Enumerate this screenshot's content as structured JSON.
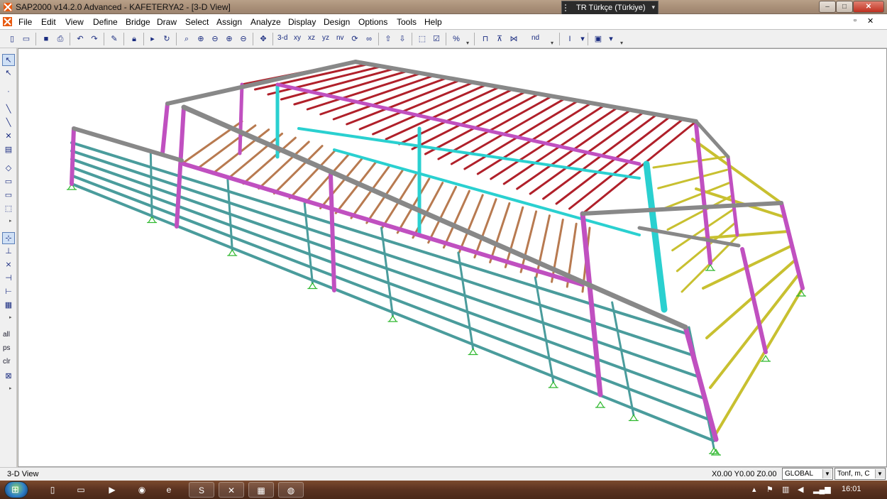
{
  "window": {
    "title": "SAP2000 v14.2.0 Advanced  - KAFETERYA2 - [3-D View]",
    "language": "TR Türkçe (Türkiye)",
    "minimize": "–",
    "maximize": "□",
    "close": "✕"
  },
  "menu": {
    "items": [
      "File",
      "Edit",
      "View",
      "Define",
      "Bridge",
      "Draw",
      "Select",
      "Assign",
      "Analyze",
      "Display",
      "Design",
      "Options",
      "Tools",
      "Help"
    ],
    "restore": "▫",
    "close": "✕"
  },
  "toolbar": {
    "view_3d": "3-d",
    "view_xy": "xy",
    "view_xz": "xz",
    "view_yz": "yz",
    "view_nv": "nv",
    "view_nd": "nd",
    "icons": [
      "new-file-icon",
      "open-folder-icon",
      "save-icon",
      "print-icon",
      "undo-icon",
      "redo-icon",
      "pencil-icon",
      "lock-icon",
      "run-icon",
      "rotate-icon",
      "zoom-window-icon",
      "zoom-in-icon",
      "zoom-out-icon",
      "zoom-extents-icon",
      "zoom-previous-icon",
      "pan-icon",
      "refresh-icon",
      "perspective-icon",
      "up-arrow-icon",
      "down-arrow-icon",
      "select-icon",
      "snap-icon",
      "percent-icon",
      "frame-section-icon",
      "brace-icon",
      "truss-icon",
      "section-i-icon",
      "color-box-icon"
    ]
  },
  "left_toolbar": {
    "labels": [
      "all",
      "ps",
      "clr"
    ],
    "icons": [
      "pointer-icon",
      "reshape-icon",
      "point-icon",
      "line-icon",
      "line2-icon",
      "cross-icon",
      "grid-icon",
      "area-icon",
      "rectangle-icon",
      "rect2-icon",
      "solid-icon",
      "snap-point-icon",
      "snap-end-icon",
      "snap-intersect-icon",
      "snap-perp-icon",
      "snap-line-icon",
      "snap-grid-icon",
      "deselect-icon"
    ]
  },
  "view": {
    "label": "3-D View"
  },
  "statusbar": {
    "view_name": "3-D View",
    "coords": "X0.00  Y0.00  Z0.00",
    "coord_system": "GLOBAL",
    "units": "Tonf, m, C"
  },
  "taskbar": {
    "clock": "16:01",
    "apps": [
      "file-icon",
      "explorer-icon",
      "media-player-icon",
      "chrome-icon",
      "ie-icon",
      "skype-icon",
      "sap2000-icon",
      "excel-icon",
      "game-icon"
    ]
  }
}
